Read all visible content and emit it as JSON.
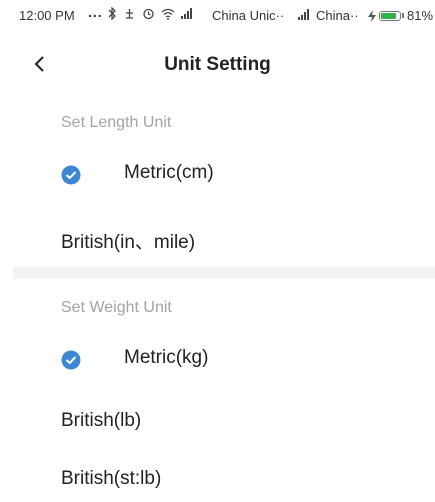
{
  "status_bar": {
    "time": "12:00 PM",
    "dots": "...",
    "carrier1": "China Unic··",
    "carrier2": "China··",
    "battery_percent_label": "81%",
    "battery_level": 0.81,
    "icons": [
      "bluetooth-icon",
      "do-not-disturb-icon",
      "alarm-icon",
      "wifi-icon",
      "signal-icon",
      "signal-icon",
      "charging-icon",
      "battery-icon"
    ]
  },
  "header": {
    "title": "Unit Setting",
    "back_icon": "chevron-left-icon"
  },
  "length_section": {
    "label": "Set Length Unit",
    "options": [
      {
        "label": "Metric(cm)",
        "selected": true
      },
      {
        "label": "British(in、mile)",
        "selected": false
      }
    ]
  },
  "weight_section": {
    "label": "Set Weight Unit",
    "options": [
      {
        "label": "Metric(kg)",
        "selected": true
      },
      {
        "label": "British(lb)",
        "selected": false
      },
      {
        "label": "British(st:lb)",
        "selected": false
      }
    ]
  },
  "colors": {
    "accent": "#3d86d4",
    "section_label": "#a3a3a3",
    "divider": "#f2f2f2"
  }
}
